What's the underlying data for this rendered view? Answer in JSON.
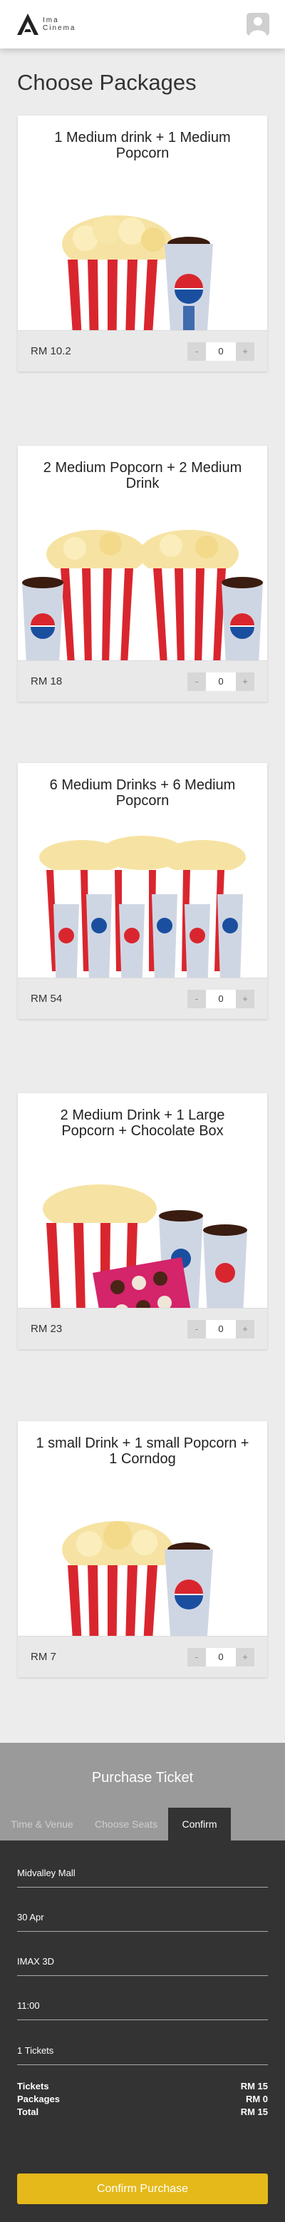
{
  "header": {
    "logo_text_line1": "Ima",
    "logo_text_line2": "Cinema"
  },
  "page_title": "Choose Packages",
  "packages": [
    {
      "title": "1 Medium drink + 1 Medium Popcorn",
      "price": "RM 10.2",
      "quantity": "0",
      "minus": "-",
      "plus": "+"
    },
    {
      "title": "2 Medium Popcorn + 2 Medium Drink",
      "price": "RM 18",
      "quantity": "0",
      "minus": "-",
      "plus": "+"
    },
    {
      "title": "6 Medium Drinks + 6 Medium Popcorn",
      "price": "RM 54",
      "quantity": "0",
      "minus": "-",
      "plus": "+"
    },
    {
      "title": "2 Medium Drink + 1 Large Popcorn + Chocolate Box",
      "price": "RM 23",
      "quantity": "0",
      "minus": "-",
      "plus": "+"
    },
    {
      "title": "1 small Drink + 1 small Popcorn + 1 Corndog",
      "price": "RM 7",
      "quantity": "0",
      "minus": "-",
      "plus": "+"
    }
  ],
  "purchase": {
    "title": "Purchase Ticket",
    "tabs": [
      "Time & Venue",
      "Choose Seats",
      "Confirm"
    ],
    "active_tab": "Confirm",
    "fields": [
      "Midvalley Mall",
      "30 Apr",
      "IMAX 3D",
      "11:00",
      "1 Tickets"
    ],
    "summary": [
      {
        "label": "Tickets",
        "value": "RM 15"
      },
      {
        "label": "Packages",
        "value": "RM 0"
      },
      {
        "label": "Total",
        "value": "RM 15"
      }
    ],
    "confirm_label": "Confirm Purchase"
  },
  "colors": {
    "accent": "#e5b91a",
    "popcorn_stripe": "#d9262e",
    "cup_blue": "#1a4fa0",
    "panel_dark": "#333333",
    "panel_head": "#9a9a9a"
  }
}
